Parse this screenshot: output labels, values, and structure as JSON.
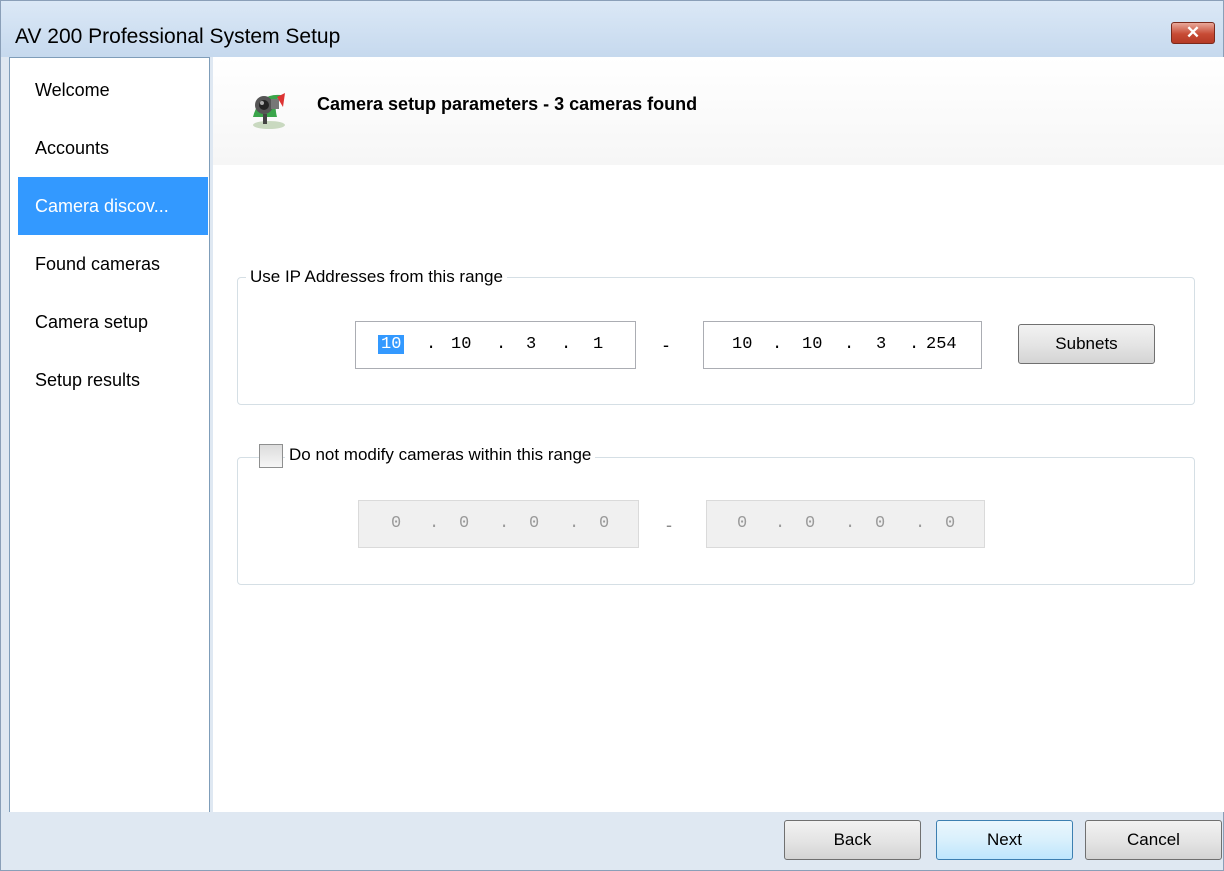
{
  "window": {
    "title": "AV 200 Professional System Setup",
    "close_glyph": "✕"
  },
  "sidebar": {
    "items": [
      {
        "label": "Welcome"
      },
      {
        "label": "Accounts"
      },
      {
        "label": "Camera discov...",
        "active": true
      },
      {
        "label": "Found cameras"
      },
      {
        "label": "Camera setup"
      },
      {
        "label": "Setup results"
      }
    ]
  },
  "header": {
    "icon": "camera-icon",
    "text": "Camera setup parameters - 3 cameras found"
  },
  "ip_range": {
    "group_label": "Use IP Addresses from this range",
    "start": [
      "10",
      "10",
      "3",
      "1"
    ],
    "end": [
      "10",
      "10",
      "3",
      "254"
    ],
    "dash": "-",
    "subnets_button": "Subnets"
  },
  "exclude_range": {
    "checkbox_label": "Do not modify cameras within this range",
    "checked": false,
    "start": [
      "0",
      "0",
      "0",
      "0"
    ],
    "end": [
      "0",
      "0",
      "0",
      "0"
    ],
    "dash": "-"
  },
  "footer": {
    "back": "Back",
    "next": "Next",
    "cancel": "Cancel"
  },
  "colors": {
    "selection": "#3399ff",
    "window_bg": "#dfe8f2"
  }
}
